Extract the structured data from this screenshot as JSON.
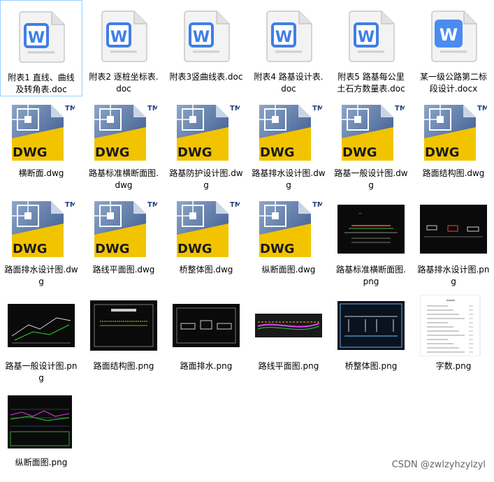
{
  "files": [
    {
      "name": "附表1 直线、曲线及转角表.doc",
      "type": "doc",
      "selected": true
    },
    {
      "name": "附表2 逐桩坐标表.doc",
      "type": "doc"
    },
    {
      "name": "附表3竖曲线表.doc",
      "type": "doc"
    },
    {
      "name": "附表4 路基设计表.doc",
      "type": "doc"
    },
    {
      "name": "附表5 路基每公里土石方数量表.doc",
      "type": "doc"
    },
    {
      "name": "某一级公路第二标段设计.docx",
      "type": "docx"
    },
    {
      "name": "横断面.dwg",
      "type": "dwg"
    },
    {
      "name": "路基标准横断面图.dwg",
      "type": "dwg"
    },
    {
      "name": "路基防护设计图.dwg",
      "type": "dwg"
    },
    {
      "name": "路基排水设计图.dwg",
      "type": "dwg"
    },
    {
      "name": "路基一般设计图.dwg",
      "type": "dwg"
    },
    {
      "name": "路面结构图.dwg",
      "type": "dwg"
    },
    {
      "name": "路面排水设计图.dwg",
      "type": "dwg"
    },
    {
      "name": "路线平面图.dwg",
      "type": "dwg"
    },
    {
      "name": "桥整体图.dwg",
      "type": "dwg"
    },
    {
      "name": "纵断面图.dwg",
      "type": "dwg"
    },
    {
      "name": "路基标准横断面图.png",
      "type": "png",
      "thumb": "cross"
    },
    {
      "name": "路基排水设计图.png",
      "type": "png",
      "thumb": "drain"
    },
    {
      "name": "路基一般设计图.png",
      "type": "png",
      "thumb": "general"
    },
    {
      "name": "路面结构图.png",
      "type": "png",
      "thumb": "structure"
    },
    {
      "name": "路面排水.png",
      "type": "png",
      "thumb": "surface"
    },
    {
      "name": "路线平面图.png",
      "type": "png",
      "thumb": "plan"
    },
    {
      "name": "桥整体图.png",
      "type": "png",
      "thumb": "bridge"
    },
    {
      "name": "字数.png",
      "type": "png",
      "thumb": "text"
    },
    {
      "name": "纵断面图.png",
      "type": "png",
      "thumb": "profile"
    }
  ],
  "icons": {
    "doc": "word-icon",
    "docx": "word-icon",
    "dwg": "dwg-icon",
    "png": "image-thumbnail"
  },
  "dwg_icon": {
    "badge": "DWG",
    "tm": "TM"
  },
  "word_letter": "W",
  "colors": {
    "word_blue": "#3f7fe6",
    "word_blue_docx": "#4a8cf0",
    "dwg_yellow": "#f2c400",
    "dwg_blue": "#3a5d9a",
    "selection": "#99d1ff"
  },
  "watermark": "CSDN @zwlzyhzylzyl"
}
